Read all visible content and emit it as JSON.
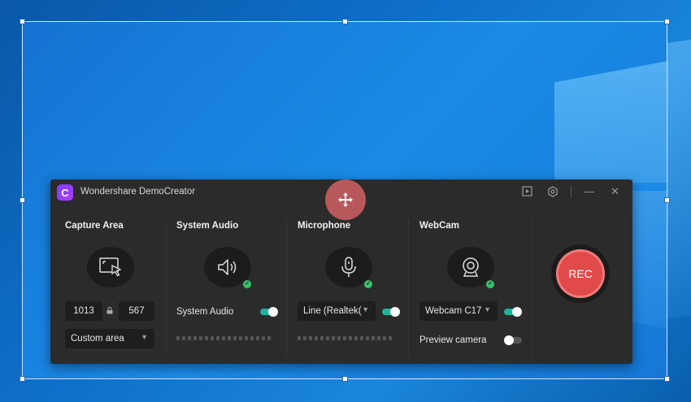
{
  "window": {
    "title": "Wondershare DemoCreator",
    "logo_letter": "C"
  },
  "titlebar_icons": {
    "play": "play-box-icon",
    "settings": "hexagon-gear-icon",
    "minimize_glyph": "—",
    "close_glyph": "✕"
  },
  "capture": {
    "title": "Capture Area",
    "width": "1013",
    "height": "567",
    "mode": "Custom area"
  },
  "system_audio": {
    "title": "System Audio",
    "toggle_label": "System Audio",
    "enabled": true
  },
  "microphone": {
    "title": "Microphone",
    "device": "Line (Realtek(",
    "enabled": true
  },
  "webcam": {
    "title": "WebCam",
    "device": "Webcam C17",
    "enabled": true,
    "preview_label": "Preview camera",
    "preview_enabled": false
  },
  "record": {
    "label": "REC"
  },
  "colors": {
    "accent_green": "#1fb39c",
    "rec_red": "#e14a4a",
    "panel_bg": "#2b2b2b"
  }
}
